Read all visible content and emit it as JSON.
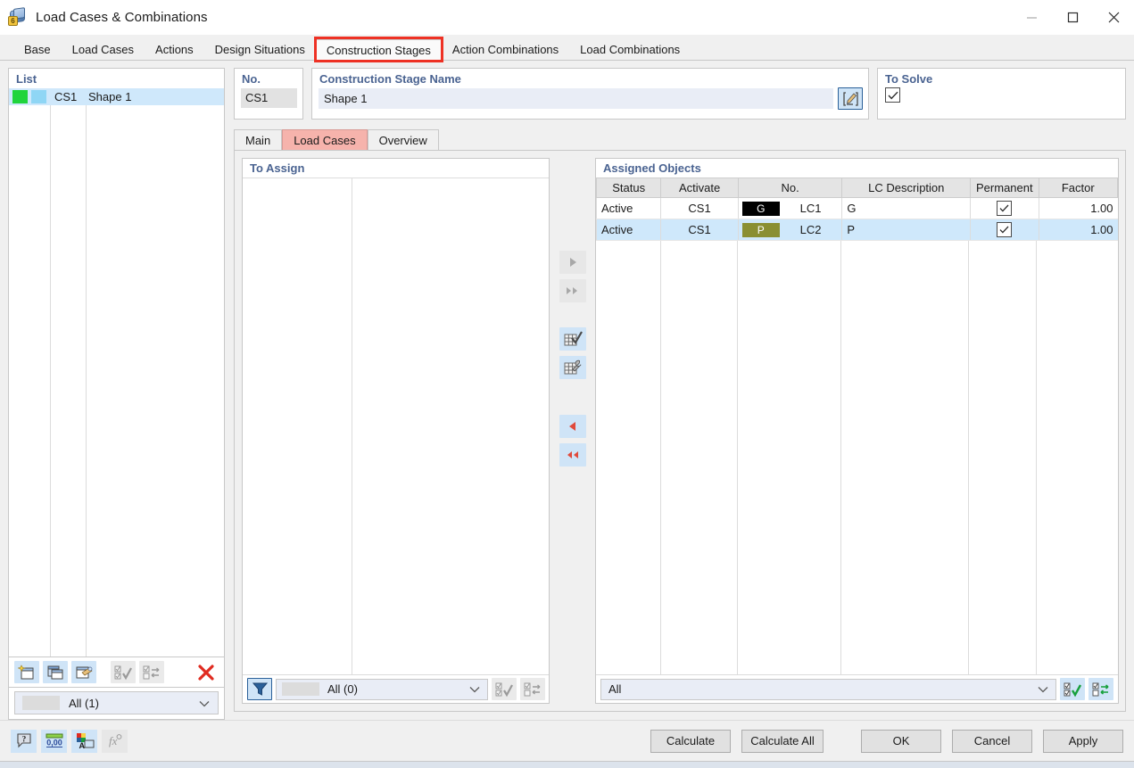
{
  "window": {
    "title": "Load Cases & Combinations",
    "icon": "load-cases-icon",
    "minimize_label": "—",
    "maximize_label": "□",
    "close_label": "✕"
  },
  "tabs": [
    {
      "label": "Base",
      "active": false
    },
    {
      "label": "Load Cases",
      "active": false
    },
    {
      "label": "Actions",
      "active": false
    },
    {
      "label": "Design Situations",
      "active": false
    },
    {
      "label": "Construction Stages",
      "active": true,
      "highlighted": true
    },
    {
      "label": "Action Combinations",
      "active": false
    },
    {
      "label": "Load Combinations",
      "active": false
    }
  ],
  "list_panel": {
    "title": "List",
    "rows": [
      {
        "color_1": "#20d43c",
        "color_2": "#8fd6f5",
        "no": "CS1",
        "name": "Shape 1",
        "selected": true
      }
    ],
    "toolbar": [
      {
        "name": "new-stage-button",
        "enabled": true
      },
      {
        "name": "copy-stage-button",
        "enabled": true
      },
      {
        "name": "edit-stage-button",
        "enabled": true
      },
      {
        "name": "select-all-button",
        "enabled": false
      },
      {
        "name": "invert-selection-button",
        "enabled": false
      },
      {
        "name": "delete-stage-button",
        "enabled": true
      }
    ],
    "filter": {
      "value": "All (1)",
      "swatch": "#dcdcdc"
    }
  },
  "no_box": {
    "title": "No.",
    "value": "CS1"
  },
  "name_box": {
    "title": "Construction Stage Name",
    "value": "Shape 1",
    "edit_button": "edit-name-button"
  },
  "solve_box": {
    "title": "To Solve",
    "checked": true
  },
  "inner_tabs": [
    {
      "label": "Main",
      "selected": false
    },
    {
      "label": "Load Cases",
      "selected": true
    },
    {
      "label": "Overview",
      "selected": false
    }
  ],
  "to_assign": {
    "title": "To Assign",
    "rows": [],
    "filter": {
      "value": "All (0)",
      "swatch": "#dcdcdc"
    },
    "filter_icon": "funnel-icon",
    "buttons": [
      {
        "name": "assign-select-all-button",
        "enabled": false
      },
      {
        "name": "assign-invert-selection-button",
        "enabled": false
      }
    ]
  },
  "transfer_buttons": [
    {
      "name": "assign-right-button",
      "glyph": "▶",
      "enabled": false
    },
    {
      "name": "assign-all-right-button",
      "glyph": "▶▶",
      "enabled": false
    },
    {
      "name": "edit-table-button",
      "glyph": "table-check-icon",
      "enabled": true
    },
    {
      "name": "settings-table-button",
      "glyph": "table-wrench-icon",
      "enabled": true
    },
    {
      "name": "unassign-left-button",
      "glyph": "◀",
      "enabled": true
    },
    {
      "name": "unassign-all-left-button",
      "glyph": "◀◀",
      "enabled": true
    }
  ],
  "assigned_objects": {
    "title": "Assigned Objects",
    "columns": [
      "Status",
      "Activate",
      "No.",
      "LC Description",
      "Permanent",
      "Factor"
    ],
    "rows": [
      {
        "status": "Active",
        "activate": "CS1",
        "badge_text": "G",
        "badge_color": "#000000",
        "no": "LC1",
        "lc_description": "G",
        "permanent": true,
        "factor": "1.00",
        "selected": false
      },
      {
        "status": "Active",
        "activate": "CS1",
        "badge_text": "P",
        "badge_color": "#8a8f33",
        "no": "LC2",
        "lc_description": "P",
        "permanent": true,
        "factor": "1.00",
        "selected": true
      }
    ],
    "filter": {
      "value": "All"
    },
    "buttons": [
      {
        "name": "objects-select-all-button",
        "enabled": true
      },
      {
        "name": "objects-invert-selection-button",
        "enabled": true
      }
    ]
  },
  "footer": {
    "icons": [
      {
        "name": "help-icon",
        "enabled": true
      },
      {
        "name": "decimal-places-icon",
        "enabled": true
      },
      {
        "name": "display-properties-icon",
        "enabled": true
      },
      {
        "name": "formula-icon",
        "enabled": false
      }
    ],
    "buttons": [
      {
        "label": "Calculate",
        "name": "calculate-button"
      },
      {
        "label": "Calculate All",
        "name": "calculate-all-button"
      },
      {
        "label": "OK",
        "name": "ok-button"
      },
      {
        "label": "Cancel",
        "name": "cancel-button"
      },
      {
        "label": "Apply",
        "name": "apply-button"
      }
    ]
  }
}
